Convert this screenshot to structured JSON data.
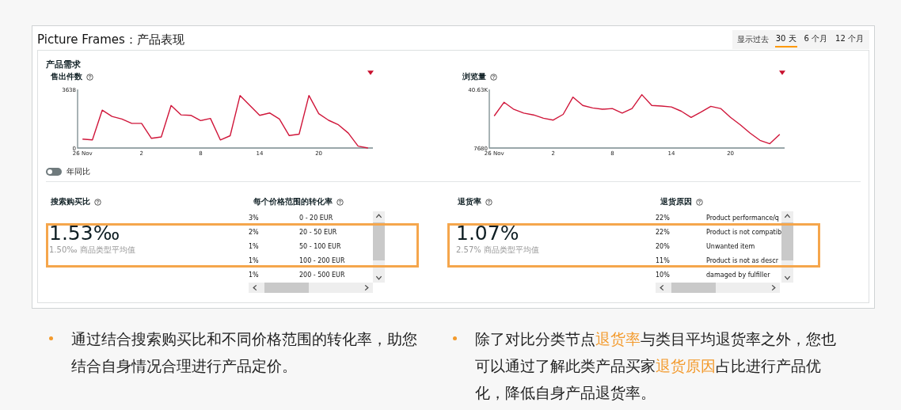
{
  "header": {
    "title": "Picture Frames：产品表现",
    "period_label": "显示过去",
    "periods": [
      {
        "label": "30 天",
        "selected": true
      },
      {
        "label": "6 个月",
        "selected": false
      },
      {
        "label": "12 个月",
        "selected": false
      }
    ]
  },
  "section_title": "产品需求",
  "charts": [
    {
      "title": "售出件数",
      "chart_data": {
        "type": "line",
        "categories": [
          "26 Nov",
          null,
          null,
          null,
          null,
          null,
          "2",
          null,
          null,
          null,
          null,
          null,
          "8",
          null,
          null,
          null,
          null,
          null,
          "14",
          null,
          null,
          null,
          null,
          null,
          "20",
          null,
          null,
          null,
          null,
          null
        ],
        "series": [
          {
            "color": "#d0163a",
            "values": [
              550,
              500,
              2350,
              1960,
              1800,
              1530,
              1530,
              600,
              690,
              2640,
              2060,
              2030,
              1700,
              1840,
              500,
              760,
              3260,
              2640,
              2030,
              2180,
              1800,
              770,
              860,
              3260,
              2130,
              1720,
              1440,
              930,
              120,
              0
            ]
          }
        ],
        "ylim": [
          0,
          3638
        ],
        "yticks": [
          0,
          3638
        ]
      }
    },
    {
      "title": "浏览量",
      "chart_data": {
        "type": "line",
        "categories": [
          "26 Nov",
          null,
          null,
          null,
          null,
          null,
          "2",
          null,
          null,
          null,
          null,
          null,
          "8",
          null,
          null,
          null,
          null,
          null,
          "14",
          null,
          null,
          null,
          null,
          null,
          "20",
          null,
          null,
          null,
          null,
          null
        ],
        "series": [
          {
            "color": "#d0163a",
            "values": [
              25700,
              33400,
              29400,
              27300,
              26300,
              24400,
              23400,
              26600,
              36300,
              31600,
              30200,
              29500,
              29900,
              27300,
              29900,
              37700,
              31600,
              31300,
              30800,
              28400,
              24900,
              27900,
              31100,
              29900,
              24900,
              20700,
              16000,
              12000,
              10100,
              15400
            ]
          }
        ],
        "ylim": [
          7680,
          40630
        ],
        "yticks": [
          {
            "value": 7680,
            "label": "7680"
          },
          {
            "value": 40630,
            "label": "40.63K"
          }
        ]
      }
    }
  ],
  "yoy_toggle": {
    "label": "年同比",
    "on": false
  },
  "groups": [
    {
      "metric": {
        "title": "搜索购买比",
        "value": "1.53‰",
        "average": "1.50‰ 商品类型平均值"
      },
      "table": {
        "title": "每个价格范围的转化率",
        "rows": [
          {
            "share": "3%",
            "label": "0 - 20 EUR"
          },
          {
            "share": "2%",
            "label": "20 - 50 EUR"
          },
          {
            "share": "1%",
            "label": "50 - 100 EUR"
          },
          {
            "share": "1%",
            "label": "100 - 200 EUR"
          },
          {
            "share": "1%",
            "label": "200 - 500 EUR"
          }
        ]
      }
    },
    {
      "metric": {
        "title": "退货率",
        "value": "1.07%",
        "average": "2.57% 商品类型平均值"
      },
      "table": {
        "title": "退货原因",
        "rows": [
          {
            "share": "22%",
            "label": "Product performance/q"
          },
          {
            "share": "22%",
            "label": "Product is not compatib"
          },
          {
            "share": "20%",
            "label": "Unwanted item"
          },
          {
            "share": "11%",
            "label": "Product is not as descr"
          },
          {
            "share": "10%",
            "label": "damaged by fulfiller"
          }
        ]
      }
    }
  ],
  "bullets": [
    {
      "text": "通过结合搜索购买比和不同价格范围的转化率，助您结合自身情况合理进行产品定价。"
    },
    {
      "text": "除了对比分类节点**退货率**与类目平均退货率之外，您也可以通过了解此类产品买家**退货原因**占比进行产品优化，降低自身产品退货率。"
    }
  ]
}
